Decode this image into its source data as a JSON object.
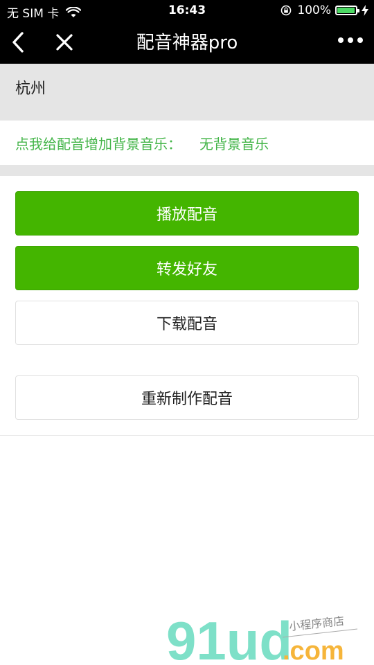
{
  "status": {
    "carrier": "无 SIM 卡",
    "time": "16:43",
    "battery": "100%",
    "battery_level": 1.0
  },
  "nav": {
    "title": "配音神器pro"
  },
  "location": {
    "text": "杭州"
  },
  "bgmusic": {
    "label": "点我给配音增加背景音乐：",
    "value": "无背景音乐"
  },
  "buttons": {
    "play": "播放配音",
    "share": "转发好友",
    "download": "下载配音",
    "remake": "重新制作配音"
  },
  "watermark": {
    "brand": "91ud",
    "suffix": ".com",
    "tagline": "小程序商店"
  },
  "colors": {
    "primary_green": "#44b500",
    "text_green": "#44b549",
    "gray_bg": "#e5e5e5"
  },
  "icons": [
    "wifi-icon",
    "lock-rotation-icon",
    "battery-icon",
    "charging-icon",
    "back-icon",
    "close-icon",
    "more-icon"
  ]
}
